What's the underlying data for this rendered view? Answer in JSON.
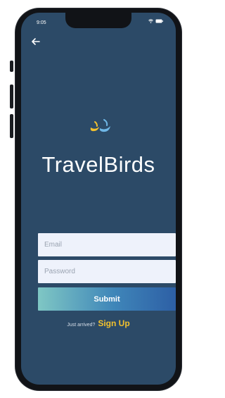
{
  "status_bar": {
    "time": "9:05"
  },
  "app": {
    "title": "TravelBirds",
    "logo_icon": "two-birds-icon"
  },
  "form": {
    "email_placeholder": "Email",
    "password_placeholder": "Password",
    "submit_label": "Submit"
  },
  "signup": {
    "prompt": "Just arrived?",
    "link": "Sign Up"
  },
  "colors": {
    "background": "#2c4a67",
    "accent": "#f2c12e"
  }
}
